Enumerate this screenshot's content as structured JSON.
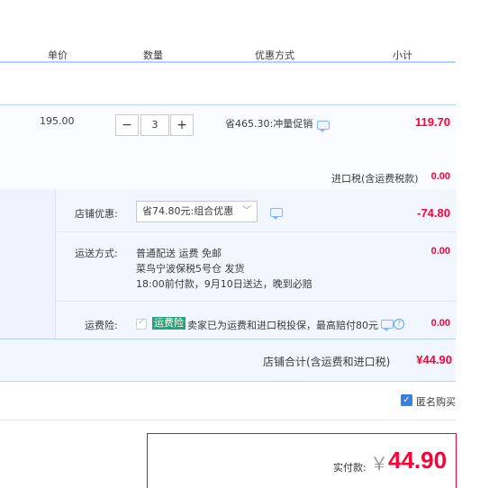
{
  "header": {
    "col_price": "单价",
    "col_qty": "数量",
    "col_discount": "优惠方式",
    "col_subtotal": "小计"
  },
  "item": {
    "unit_price": "195.00",
    "qty_minus": "−",
    "qty_value": "3",
    "qty_plus": "+",
    "promo": "省465.30:冲量促销",
    "subtotal": "119.70"
  },
  "import_tax": {
    "label": "进口税(含运费税款)",
    "value": "0.00"
  },
  "shop_discount": {
    "label": "店铺优惠:",
    "selected": "省74.80元:组合优惠",
    "value": "-74.80"
  },
  "shipping": {
    "label": "运送方式:",
    "line1": "普通配送 运费 免邮",
    "line2": "菜鸟宁波保税5号仓  发货",
    "line3": "18:00前付款，9月10日送达，晚到必赔",
    "value": "0.00"
  },
  "insurance": {
    "label": "运费险:",
    "tag": "运费险",
    "text": "卖家已为运费和进口税投保，最高赔付80元",
    "value": "0.00"
  },
  "shop_total": {
    "label": "店铺合计(含运费和进口税)",
    "value": "¥44.90"
  },
  "anonymous": {
    "label": "匿名购买"
  },
  "payment": {
    "label": "实付款:",
    "currency": "￥",
    "amount": "44.90"
  },
  "colors": {
    "accent_red": "#ff0036",
    "accent_blue": "#b2d1ff",
    "tag_green": "#27a377"
  }
}
